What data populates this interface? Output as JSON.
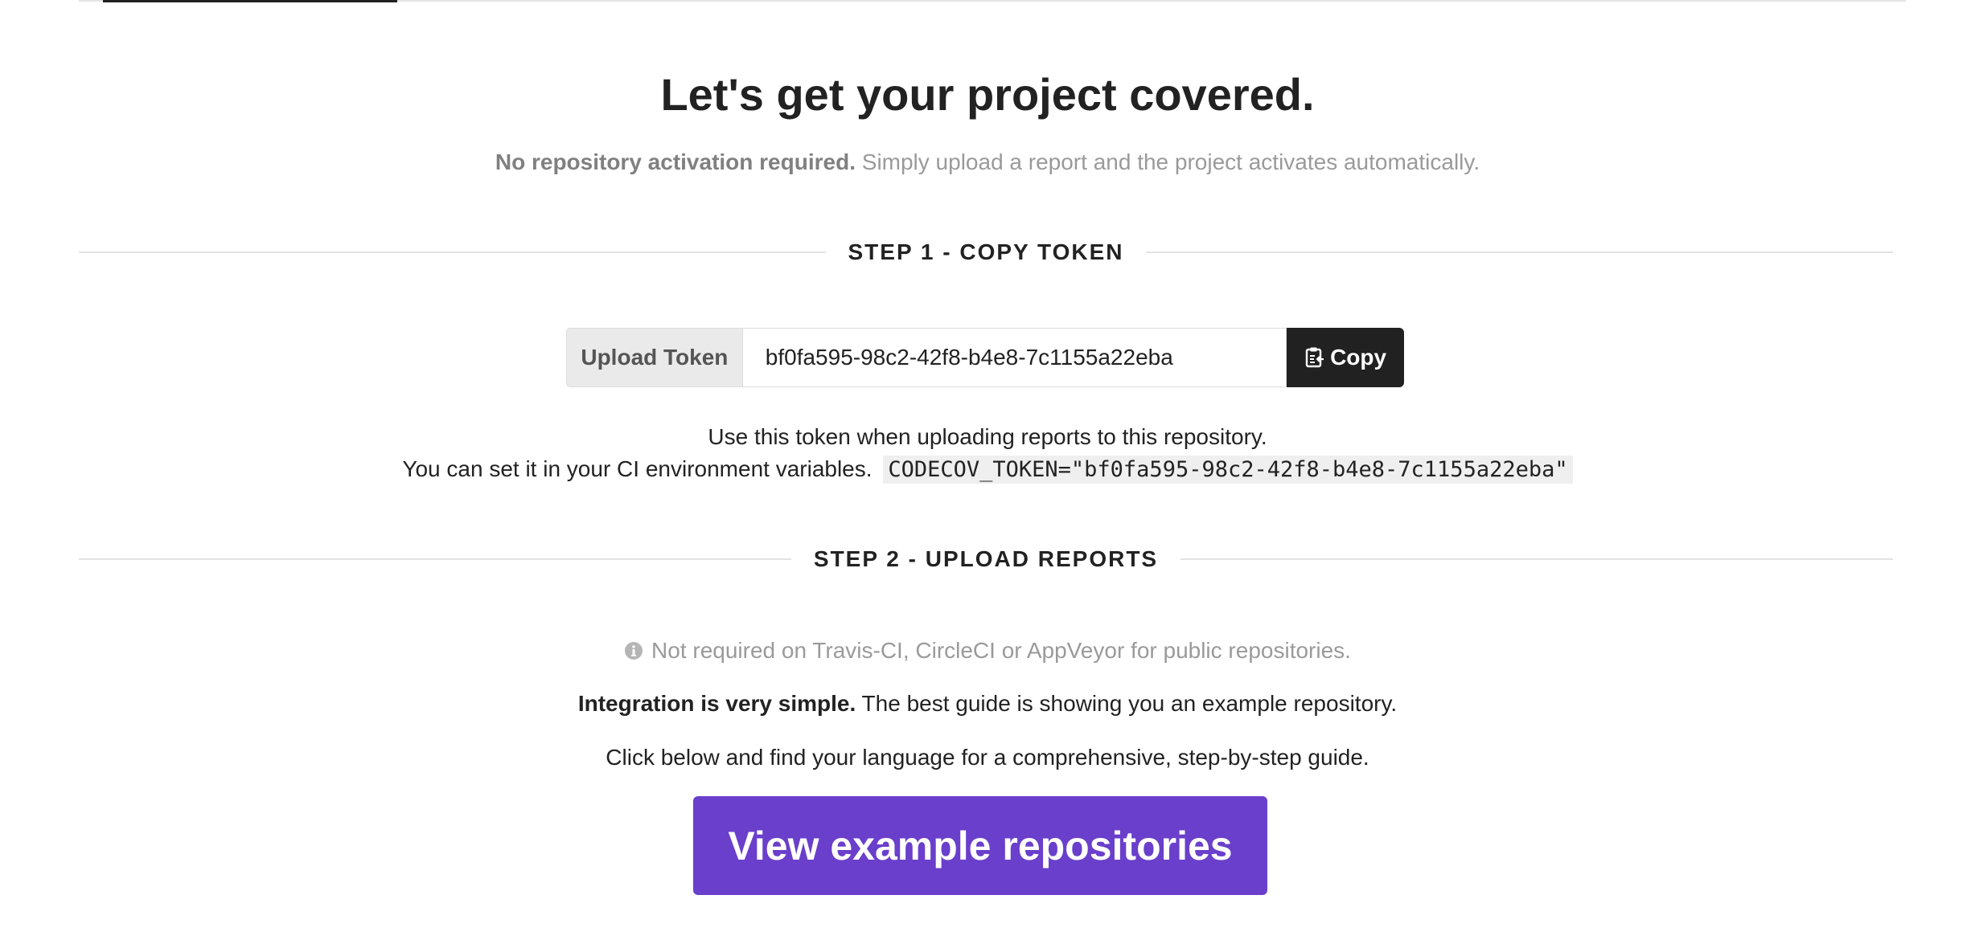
{
  "header": {
    "title": "Let's get your project covered.",
    "subtitle_bold": "No repository activation required.",
    "subtitle_rest": " Simply upload a report and the project activates automatically."
  },
  "step1": {
    "label": "STEP 1 - COPY TOKEN",
    "token_label": "Upload Token",
    "token_value": "bf0fa595-98c2-42f8-b4e8-7c1155a22eba",
    "copy_label": "Copy",
    "copy_icon": "clipboard-icon",
    "help_line1": "Use this token when uploading reports to this repository.",
    "help_line2": "You can set it in your CI environment variables.",
    "env_snippet": "CODECOV_TOKEN=\"bf0fa595-98c2-42f8-b4e8-7c1155a22eba\""
  },
  "step2": {
    "label": "STEP 2 - UPLOAD REPORTS",
    "info_icon": "info-icon",
    "info_text": "Not required on Travis-CI, CircleCI or AppVeyor for public repositories.",
    "integration_bold": "Integration is very simple.",
    "integration_rest": " The best guide is showing you an example repository.",
    "guide_text": "Click below and find your language for a comprehensive, step-by-step guide.",
    "button_label": "View example repositories"
  },
  "colors": {
    "accent": "#6a3fcb",
    "dark_button": "#212121",
    "muted_text": "#9a9a9a"
  }
}
